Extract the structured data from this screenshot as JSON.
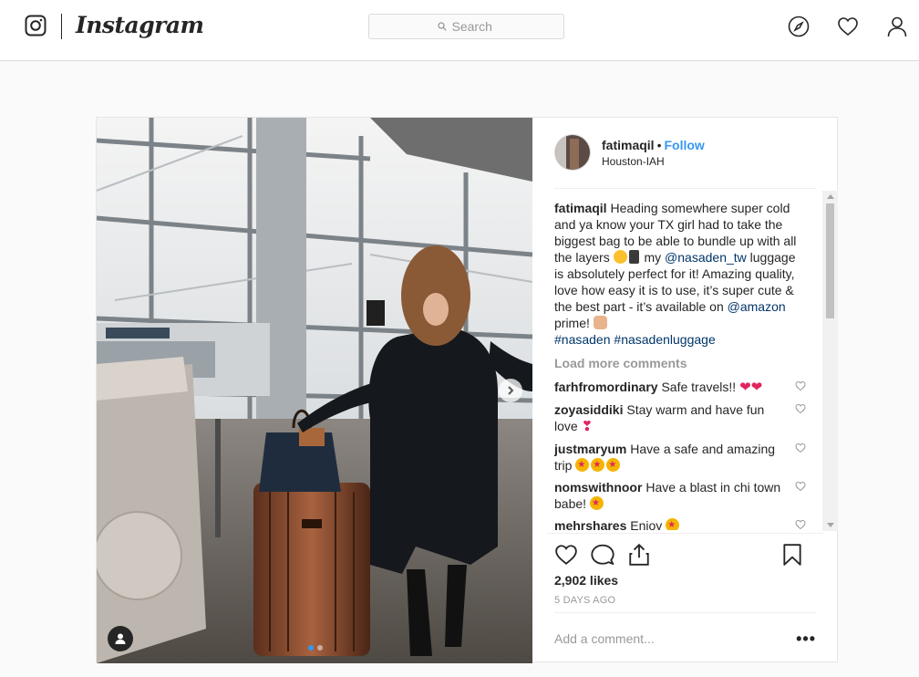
{
  "header": {
    "brand": "Instagram",
    "search_placeholder": "Search"
  },
  "post": {
    "author": {
      "username": "fatimaqil",
      "follow_label": "Follow",
      "separator": "•",
      "location": "Houston-IAH"
    },
    "caption": {
      "username": "fatimaqil",
      "text_1": "Heading somewhere super cold and ya know your TX girl had to take the biggest bag to be able to bundle up with all the layers",
      "text_2": "my",
      "mention_1": "@nasaden_tw",
      "text_3": "luggage is absolutely perfect for it! Amazing quality, love how easy it is to use, it’s super cute & the best part - it’s available on",
      "mention_2": "@amazon",
      "text_4": "prime!",
      "hashtag_1": "#nasaden",
      "hashtag_2": "#nasadenluggage"
    },
    "load_more_label": "Load more comments",
    "comments": [
      {
        "user": "farhfromordinary",
        "text": "Safe travels!!"
      },
      {
        "user": "zoyasiddiki",
        "text": "Stay warm and have fun love"
      },
      {
        "user": "justmaryum",
        "text": "Have a safe and amazing trip"
      },
      {
        "user": "nomswithnoor",
        "text": "Have a blast in chi town babe!"
      },
      {
        "user": "mehrshares",
        "text": "Enjoy"
      }
    ],
    "likes": "2,902 likes",
    "timestamp": "5 DAYS AGO",
    "add_comment_placeholder": "Add a comment...",
    "more_label": "•••",
    "carousel": {
      "total": 2,
      "current": 1
    }
  },
  "colors": {
    "link": "#003569",
    "follow": "#3897f0",
    "muted": "#999999",
    "border": "#dbdbdb"
  }
}
